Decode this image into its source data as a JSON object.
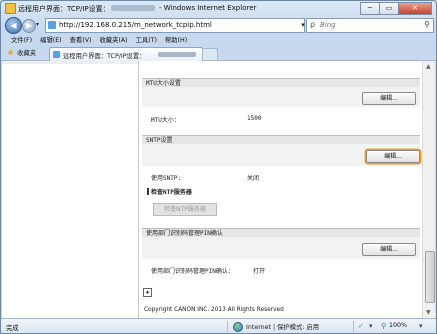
{
  "window": {
    "title": "远程用户界面：TCP/IP设置：",
    "title_suffix": "- Windows Internet Explorer",
    "min": "─",
    "max": "▭",
    "close": "✕"
  },
  "address": {
    "url": "http://192.168.0.215/m_network_tcpip.html",
    "search_placeholder": "Bing"
  },
  "menu": [
    "文件(F)",
    "编辑(E)",
    "查看(V)",
    "收藏夹(A)",
    "工具(T)",
    "帮助(H)"
  ],
  "favorites": {
    "label": "收藏夹",
    "tab_title": "远程用户界面：TCP/IP设置："
  },
  "page": {
    "mtu": {
      "header": "MTU大小设置",
      "edit": "编辑...",
      "label": "MTU大小：",
      "value": "1500"
    },
    "sntp": {
      "header": "SNTP设置",
      "edit": "编辑...",
      "label": "使用SNTP:",
      "value": "关闭",
      "check_heading": "检查NTP服务器",
      "check_button": "检查NTP服务器"
    },
    "pin": {
      "header": "使用部门识别码管理PIN确认",
      "edit": "编辑...",
      "label": "使用部门识别码管理PIN确认:",
      "value": "打开"
    },
    "top_icon": "▲",
    "copyright": "Copyright CANON INC. 2013 All Rights Reserved"
  },
  "status": {
    "text": "完成",
    "zone": "Internet | 保护模式: 启用",
    "zoom": "100%"
  }
}
